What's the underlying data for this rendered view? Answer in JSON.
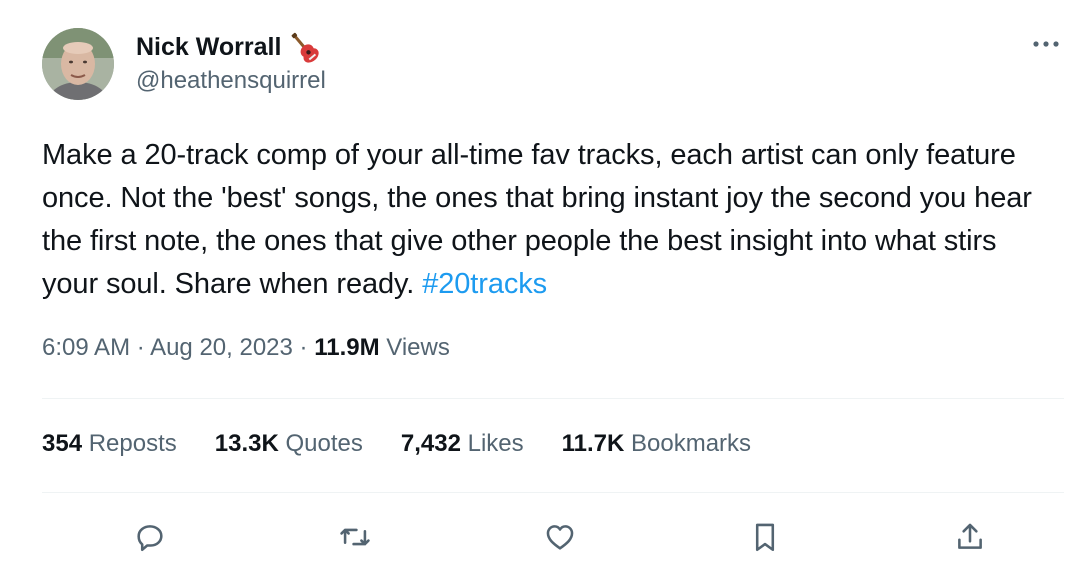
{
  "author": {
    "name": "Nick Worrall",
    "handle": "@heathensquirrel",
    "emoji_icon": "guitar-icon"
  },
  "tweet": {
    "text": "Make a 20-track comp of your all-time fav tracks, each artist can only feature once. Not the 'best' songs, the ones that bring instant joy the second you hear the first note, the ones that give other people the best insight into what stirs your soul. Share when ready. ",
    "hashtag": "#20tracks"
  },
  "meta": {
    "time": "6:09 AM",
    "separator": " · ",
    "date": "Aug 20, 2023",
    "views_count": "11.9M",
    "views_label": " Views"
  },
  "stats": {
    "reposts": {
      "count": "354",
      "label": " Reposts"
    },
    "quotes": {
      "count": "13.3K",
      "label": " Quotes"
    },
    "likes": {
      "count": "7,432",
      "label": " Likes"
    },
    "bookmarks": {
      "count": "11.7K",
      "label": " Bookmarks"
    }
  },
  "colors": {
    "accent": "#1d9bf0",
    "secondary_text": "#536471",
    "primary_text": "#0f1419"
  }
}
